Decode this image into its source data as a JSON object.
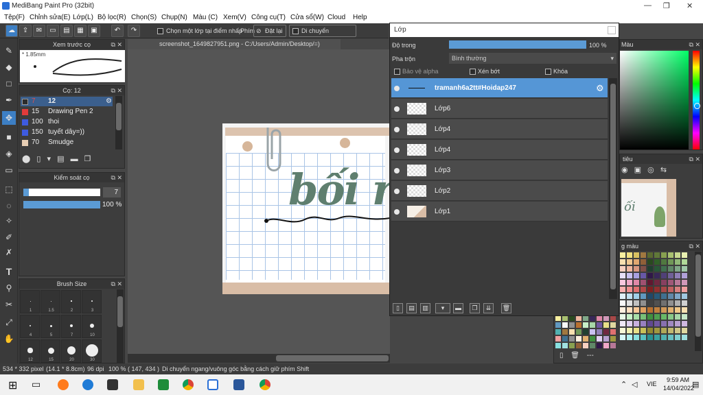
{
  "app": {
    "title": "MediBang Paint Pro (32bit)"
  },
  "menu": [
    "Tệp(F)",
    "Chỉnh sửa(E)",
    "Lớp(L)",
    "Bộ lọc(R)",
    "Chọn(S)",
    "Chụp(N)",
    "Màu (C)",
    "Xem(V)",
    "Công cụ(T)",
    "Cửa sổ(W)",
    "Cloud",
    "Help"
  ],
  "toolbar": {
    "select_layer_label": "Chọn một lớp tại điểm nhấp",
    "key_label": "Phím",
    "reset_label": "Đặt lại",
    "move_label": "Di chuyển ngang/dọc"
  },
  "tab": {
    "label": "screenshot_1649827951.png - C:/Users/Admin/Desktop/=)"
  },
  "preview": {
    "title": "Xem trước cọ",
    "size": "1.85mm"
  },
  "brush_panel": {
    "title": "Cọ: 12",
    "items": [
      {
        "size": "7",
        "name": "12",
        "color": "#2b2b2b"
      },
      {
        "size": "15",
        "name": "Drawing Pen 2",
        "color": "#e23b3b"
      },
      {
        "size": "100",
        "name": "thoi",
        "color": "#3e5be0"
      },
      {
        "size": "150",
        "name": "tuyết dây=))",
        "color": "#3e5be0"
      },
      {
        "size": "70",
        "name": "Smudge",
        "color": "#e8cfb5"
      }
    ]
  },
  "control": {
    "title": "Kiểm soát cọ",
    "size_value": "7",
    "opacity_value": "100 %",
    "size_fraction": 0.07,
    "opacity_fraction": 1.0
  },
  "brush_size": {
    "title": "Brush Size",
    "labels": [
      "1",
      "1.5",
      "2",
      "3",
      "4",
      "5",
      "7",
      "10",
      "12",
      "15",
      "20",
      "30"
    ]
  },
  "canvas": {
    "text": "bối rối"
  },
  "layer": {
    "title": "Lớp",
    "opacity_label": "Độ trong",
    "opacity_value": "100 %",
    "blend_label": "Pha trộn",
    "blend_value": "Bình thường",
    "protect_alpha": "Bảo vệ alpha",
    "clipping": "Xén bớt",
    "lock": "Khóa",
    "rows": [
      "tramanh6a2tt#Hoidap247",
      "Lớp6",
      "Lớp4",
      "Lớp4",
      "Lớp3",
      "Lớp2",
      "Lớp1"
    ]
  },
  "right_panels": {
    "color_title": "Màu",
    "nav_title": "tiêu",
    "palette_title": "g màu"
  },
  "status": {
    "dimensions": "534 * 332 pixel",
    "physical": "(14.1 * 8.8cm)",
    "dpi": "96 dpi",
    "zoom": "100 %",
    "coords": "( 147, 434 )",
    "hint": "Di chuyển ngang/vuông góc bằng cách giữ phím Shift"
  },
  "taskbar": {
    "lang": "VIE",
    "time": "9:59 AM",
    "date": "14/04/2022"
  },
  "palette_dash": "---"
}
